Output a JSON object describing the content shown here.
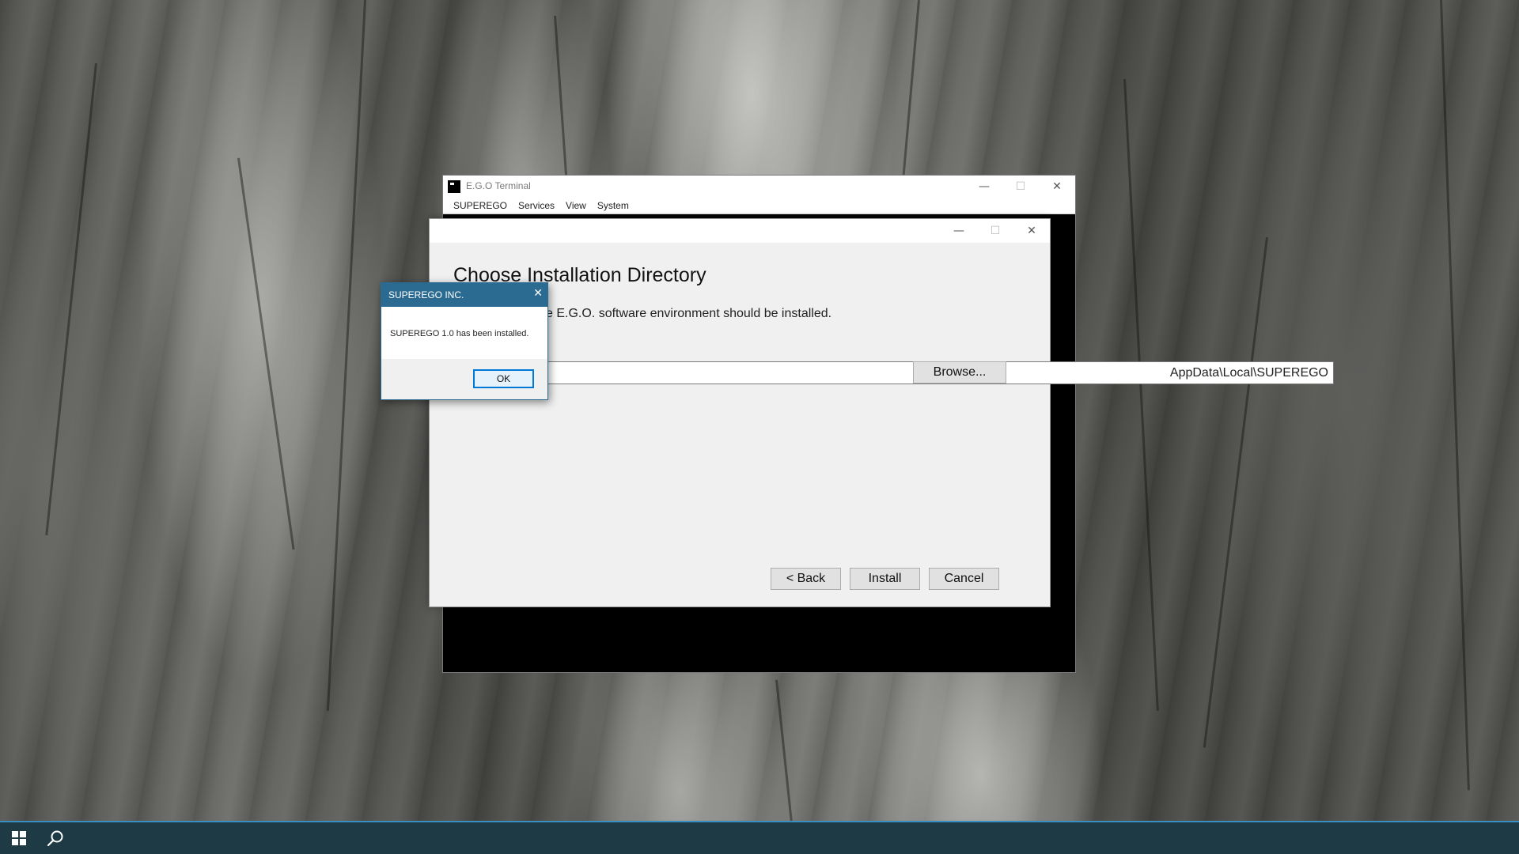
{
  "terminal": {
    "title": "E.G.O Terminal",
    "menu": [
      "SUPEREGO",
      "Services",
      "View",
      "System"
    ]
  },
  "installer": {
    "heading": "Choose Installation Directory",
    "description_visible": "e E.G.O. software environment should be installed.",
    "path_visible": "AppData\\Local\\SUPEREGO",
    "browse_label": "Browse...",
    "back_label": "< Back",
    "install_label": "Install",
    "cancel_label": "Cancel"
  },
  "message_box": {
    "title": "SUPEREGO INC.",
    "message": "SUPEREGO 1.0 has been installed.",
    "ok_label": "OK",
    "accent_color": "#2b6b91"
  },
  "taskbar": {
    "icons": [
      "windows-start-icon",
      "search-icon"
    ],
    "color": "#1d3a45"
  }
}
